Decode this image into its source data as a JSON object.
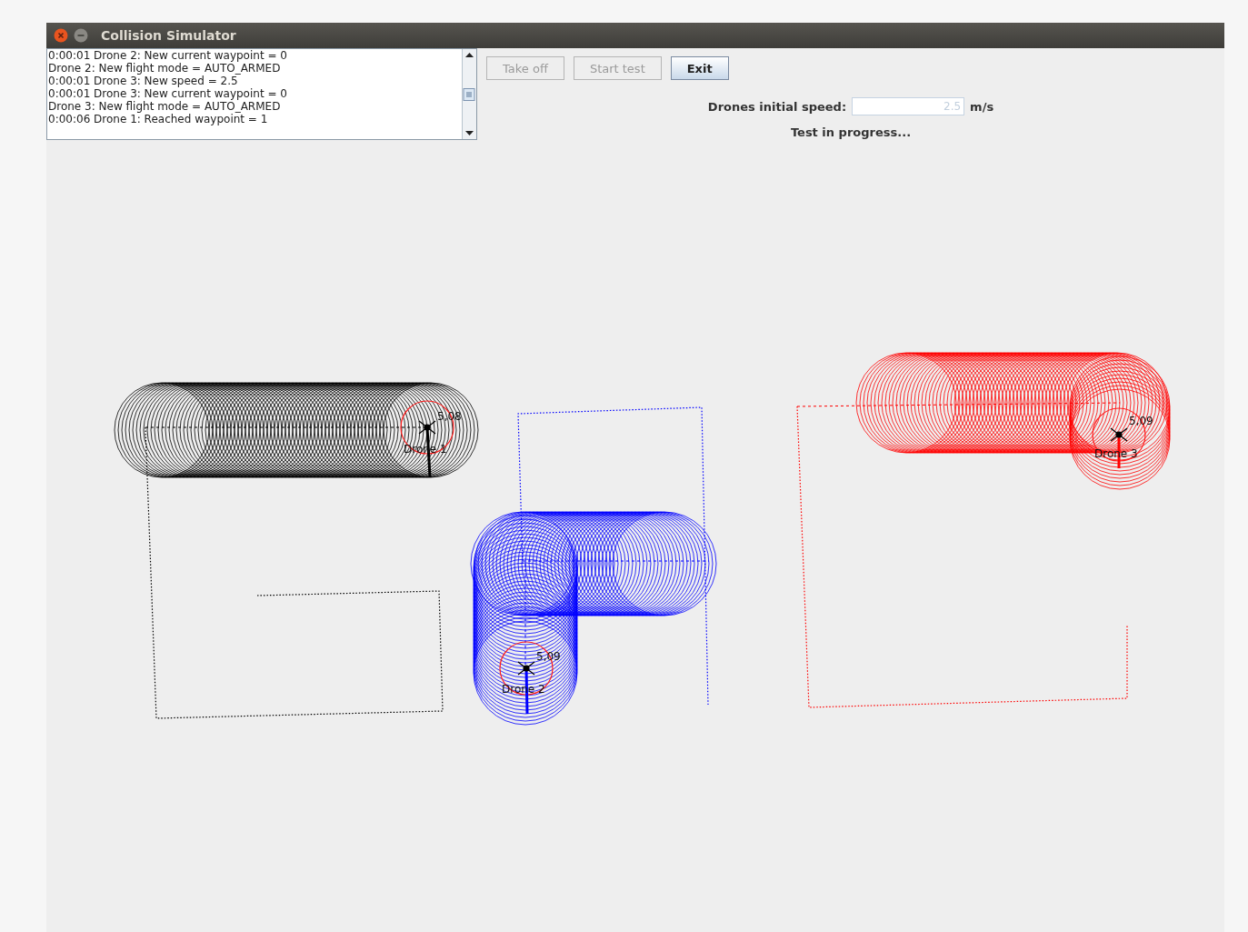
{
  "window": {
    "title": "Collision Simulator"
  },
  "log": [
    "0:00:01 Drone 2: New current waypoint = 0",
    "Drone 2: New flight mode = AUTO_ARMED",
    "0:00:01 Drone 3: New speed = 2.5",
    "0:00:01 Drone 3: New current waypoint = 0",
    "Drone 3: New flight mode = AUTO_ARMED",
    "0:00:06 Drone 1: Reached waypoint = 1"
  ],
  "buttons": [
    {
      "label": "Take off",
      "disabled": true
    },
    {
      "label": "Start test",
      "disabled": true
    },
    {
      "label": "Exit",
      "disabled": false
    }
  ],
  "speed": {
    "label": "Drones initial speed:",
    "value": "2.5",
    "unit": "m/s",
    "disabled": true
  },
  "status": "Test in progress...",
  "drones": [
    {
      "label": "Drone 1",
      "reading": "5,08",
      "color": "#000000"
    },
    {
      "label": "Drone 2",
      "reading": "5,09",
      "color": "#0000ff"
    },
    {
      "label": "Drone 3",
      "reading": "5,09",
      "color": "#ff0000"
    }
  ]
}
